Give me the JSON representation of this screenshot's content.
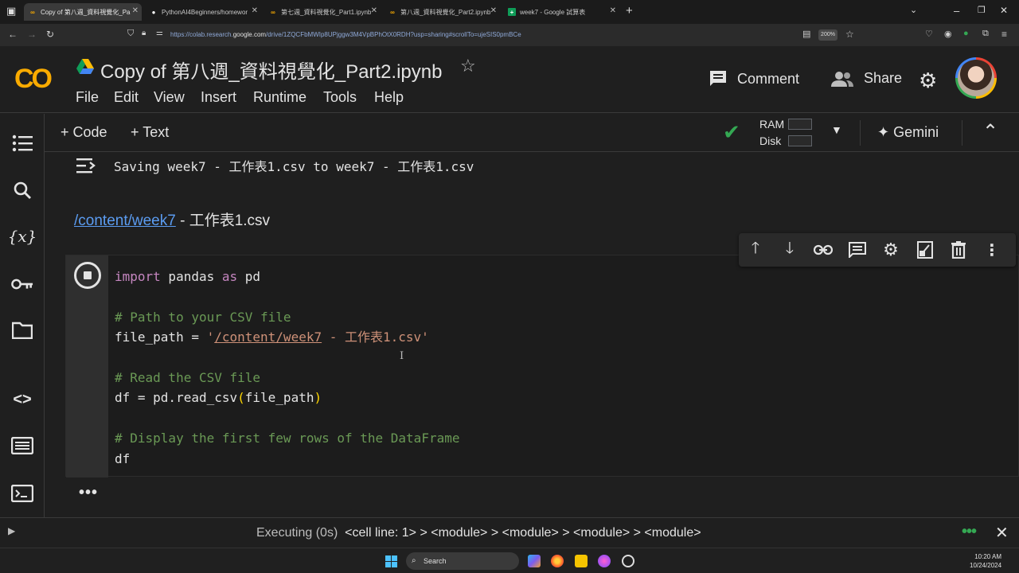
{
  "browser": {
    "tabs": [
      {
        "label": "Copy of 第八週_資料視覺化_Pa",
        "icon": "colab-icon",
        "active": true
      },
      {
        "label": "PythonAI4Beginners/homewor",
        "icon": "github-icon",
        "active": false
      },
      {
        "label": "第七週_資料視覺化_Part1.ipynb",
        "icon": "colab-icon",
        "active": false
      },
      {
        "label": "第八週_資料視覺化_Part2.ipynb",
        "icon": "colab-icon",
        "active": false
      },
      {
        "label": "week7 - Google 試算表",
        "icon": "sheets-icon",
        "active": false
      }
    ],
    "url_prefix": "https://colab.research.",
    "url_domain": "google.com",
    "url_rest": "/drive/1ZQCFbMWIp8UPjggw3M4VpBPhOtX0RDH?usp=sharing#scrollTo=ujeSIS0pmBCe",
    "zoom": "200%"
  },
  "colab": {
    "logo": "CO",
    "title": "Copy of 第八週_資料視覺化_Part2.ipynb",
    "menu": [
      "File",
      "Edit",
      "View",
      "Insert",
      "Runtime",
      "Tools",
      "Help"
    ],
    "comment_label": "Comment",
    "share_label": "Share",
    "add_code_label": "+ Code",
    "add_text_label": "+ Text",
    "ram_label": "RAM",
    "disk_label": "Disk",
    "ram_usage": 0.0,
    "disk_usage": 0.0,
    "gemini_label": "Gemini"
  },
  "notebook": {
    "output_text": "Saving week7 - 工作表1.csv to week7 - 工作表1.csv",
    "link_text": "/content/week7",
    "link_suffix": " - 工作表1.csv",
    "code": {
      "l1_kw1": "import",
      "l1_mid": " pandas ",
      "l1_kw2": "as",
      "l1_end": " pd",
      "l2": "# Path to your CSV file",
      "l3_pre": "file_path = ",
      "l3_q1": "'",
      "l3_path": "/content/week7",
      "l3_rest": " - 工作表1.csv'",
      "l4": "# Read the CSV file",
      "l5_pre": "df = pd.read_csv",
      "l5_p1": "(",
      "l5_arg": "file_path",
      "l5_p2": ")",
      "l6": "# Display the first few rows of the DataFrame",
      "l7": "df"
    }
  },
  "status": {
    "executing": "Executing (0s)",
    "trace": "<cell line: 1> > <module> > <module> > <module> > <module>"
  },
  "taskbar": {
    "search_label": "Search",
    "time": "10:20 AM",
    "date": "10/24/2024"
  }
}
